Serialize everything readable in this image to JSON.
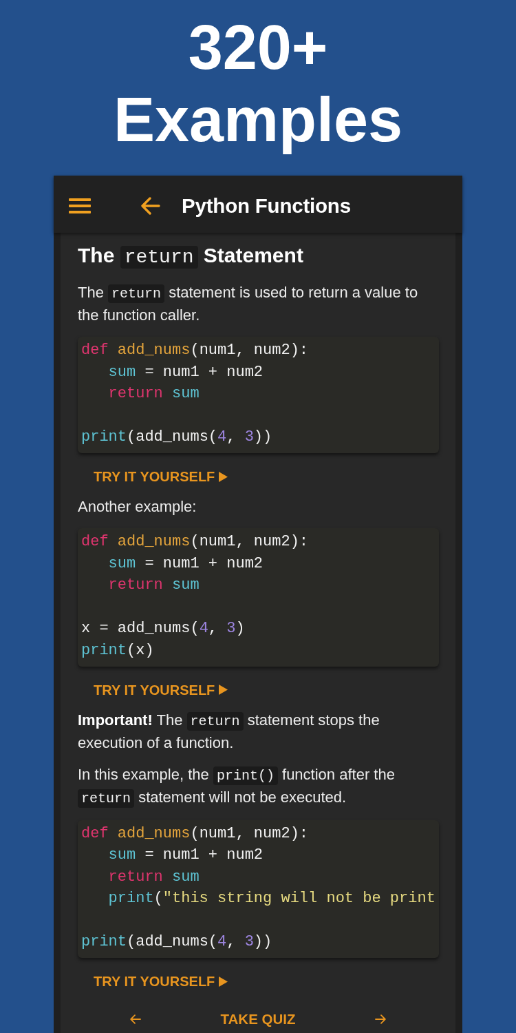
{
  "promo": {
    "title": "320+ Examples"
  },
  "app_bar": {
    "title": "Python Functions"
  },
  "content": [
    {
      "kind": "heading",
      "segments": [
        {
          "kind": "text",
          "text": "The "
        },
        {
          "kind": "code",
          "text": "return"
        },
        {
          "kind": "text",
          "text": " Statement"
        }
      ]
    },
    {
      "kind": "paragraph",
      "segments": [
        {
          "kind": "text",
          "text": "The "
        },
        {
          "kind": "code",
          "text": "return"
        },
        {
          "kind": "text",
          "text": " statement is used to return a value to the function caller."
        }
      ]
    },
    {
      "kind": "code",
      "lines": [
        {
          "kind": "code",
          "indented": false,
          "tokens": [
            {
              "kind": "keyword",
              "text": "def "
            },
            {
              "kind": "function",
              "text": "add_nums"
            },
            {
              "kind": "plain",
              "text": "(num1, num2):"
            }
          ]
        },
        {
          "kind": "code",
          "indented": true,
          "tokens": [
            {
              "kind": "name",
              "text": "sum"
            },
            {
              "kind": "plain",
              "text": " = num1 + num2"
            }
          ]
        },
        {
          "kind": "code",
          "indented": true,
          "tokens": [
            {
              "kind": "keyword",
              "text": "return "
            },
            {
              "kind": "name",
              "text": "sum"
            }
          ]
        },
        {
          "kind": "blank"
        },
        {
          "kind": "code",
          "indented": false,
          "tokens": [
            {
              "kind": "name",
              "text": "print"
            },
            {
              "kind": "plain",
              "text": "(add_nums("
            },
            {
              "kind": "number",
              "text": "4"
            },
            {
              "kind": "plain",
              "text": ", "
            },
            {
              "kind": "number",
              "text": "3"
            },
            {
              "kind": "plain",
              "text": "))"
            }
          ]
        }
      ]
    },
    {
      "kind": "link",
      "label": "TRY IT YOURSELF"
    },
    {
      "kind": "paragraph",
      "segments": [
        {
          "kind": "text",
          "text": "Another example:"
        }
      ]
    },
    {
      "kind": "code",
      "lines": [
        {
          "kind": "code",
          "indented": false,
          "tokens": [
            {
              "kind": "keyword",
              "text": "def "
            },
            {
              "kind": "function",
              "text": "add_nums"
            },
            {
              "kind": "plain",
              "text": "(num1, num2):"
            }
          ]
        },
        {
          "kind": "code",
          "indented": true,
          "tokens": [
            {
              "kind": "name",
              "text": "sum"
            },
            {
              "kind": "plain",
              "text": " = num1 + num2"
            }
          ]
        },
        {
          "kind": "code",
          "indented": true,
          "tokens": [
            {
              "kind": "keyword",
              "text": "return "
            },
            {
              "kind": "name",
              "text": "sum"
            }
          ]
        },
        {
          "kind": "blank"
        },
        {
          "kind": "code",
          "indented": false,
          "tokens": [
            {
              "kind": "plain",
              "text": "x = add_nums("
            },
            {
              "kind": "number",
              "text": "4"
            },
            {
              "kind": "plain",
              "text": ", "
            },
            {
              "kind": "number",
              "text": "3"
            },
            {
              "kind": "plain",
              "text": ")"
            }
          ]
        },
        {
          "kind": "code",
          "indented": false,
          "tokens": [
            {
              "kind": "name",
              "text": "print"
            },
            {
              "kind": "plain",
              "text": "(x)"
            }
          ]
        }
      ]
    },
    {
      "kind": "link",
      "label": "TRY IT YOURSELF"
    },
    {
      "kind": "paragraph",
      "segments": [
        {
          "kind": "text",
          "text": "**Important!** The "
        },
        {
          "kind": "code",
          "text": "return"
        },
        {
          "kind": "text",
          "text": " statement stops the execution of a function."
        }
      ]
    },
    {
      "kind": "paragraph",
      "segments": [
        {
          "kind": "text",
          "text": "In this example, the "
        },
        {
          "kind": "code",
          "text": "print()"
        },
        {
          "kind": "text",
          "text": " function after the "
        },
        {
          "kind": "code",
          "text": "return"
        },
        {
          "kind": "text",
          "text": " statement will not be executed."
        }
      ]
    },
    {
      "kind": "code",
      "lines": [
        {
          "kind": "code",
          "indented": false,
          "tokens": [
            {
              "kind": "keyword",
              "text": "def "
            },
            {
              "kind": "function",
              "text": "add_nums"
            },
            {
              "kind": "plain",
              "text": "(num1, num2):"
            }
          ]
        },
        {
          "kind": "code",
          "indented": true,
          "tokens": [
            {
              "kind": "name",
              "text": "sum"
            },
            {
              "kind": "plain",
              "text": " = num1 + num2"
            }
          ]
        },
        {
          "kind": "code",
          "indented": true,
          "tokens": [
            {
              "kind": "keyword",
              "text": "return "
            },
            {
              "kind": "name",
              "text": "sum"
            }
          ]
        },
        {
          "kind": "code",
          "indented": true,
          "tokens": [
            {
              "kind": "name",
              "text": "print"
            },
            {
              "kind": "plain",
              "text": "("
            },
            {
              "kind": "string",
              "text": "\"this string will not be print"
            }
          ]
        },
        {
          "kind": "blank"
        },
        {
          "kind": "code",
          "indented": false,
          "tokens": [
            {
              "kind": "name",
              "text": "print"
            },
            {
              "kind": "plain",
              "text": "(add_nums("
            },
            {
              "kind": "number",
              "text": "4"
            },
            {
              "kind": "plain",
              "text": ", "
            },
            {
              "kind": "number",
              "text": "3"
            },
            {
              "kind": "plain",
              "text": "))"
            }
          ]
        }
      ]
    },
    {
      "kind": "link",
      "label": "TRY IT YOURSELF"
    }
  ],
  "bottom_nav": {
    "label": "TAKE QUIZ"
  }
}
